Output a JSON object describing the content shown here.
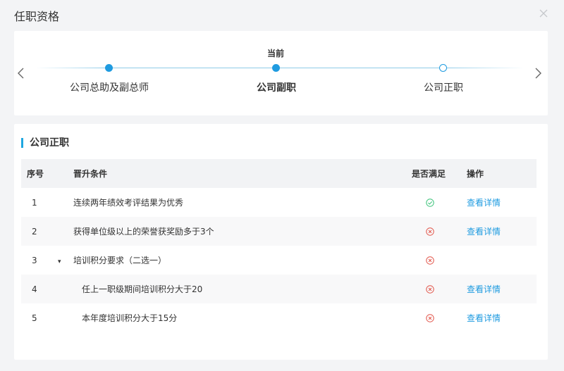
{
  "dialog": {
    "title": "任职资格"
  },
  "steps": {
    "current_tag": "当前",
    "items": [
      {
        "label": "公司总助及副总师",
        "state": "done"
      },
      {
        "label": "公司副职",
        "state": "current"
      },
      {
        "label": "公司正职",
        "state": "todo"
      }
    ]
  },
  "section": {
    "title": "公司正职"
  },
  "table": {
    "headers": {
      "no": "序号",
      "condition": "晋升条件",
      "satisfied": "是否满足",
      "action": "操作"
    },
    "rows": [
      {
        "no": "1",
        "condition": "连续两年绩效考评结果为优秀",
        "status": "check-icon",
        "action": "查看详情"
      },
      {
        "no": "2",
        "condition": "获得单位级以上的荣誉获奖励多于3个",
        "status": "cross-icon",
        "action": "查看详情"
      },
      {
        "no": "3",
        "condition": "培训积分要求（二选一）",
        "status": "cross-icon",
        "action": "",
        "toggle": "▾"
      },
      {
        "no": "4",
        "condition": "任上一职级期间培训积分大于20",
        "status": "cross-icon",
        "action": "查看详情"
      },
      {
        "no": "5",
        "condition": "本年度培训积分大于15分",
        "status": "cross-icon",
        "action": "查看详情"
      }
    ]
  },
  "colors": {
    "accent": "#1f9be0",
    "success": "#3cc37a",
    "danger": "#e2574c"
  }
}
